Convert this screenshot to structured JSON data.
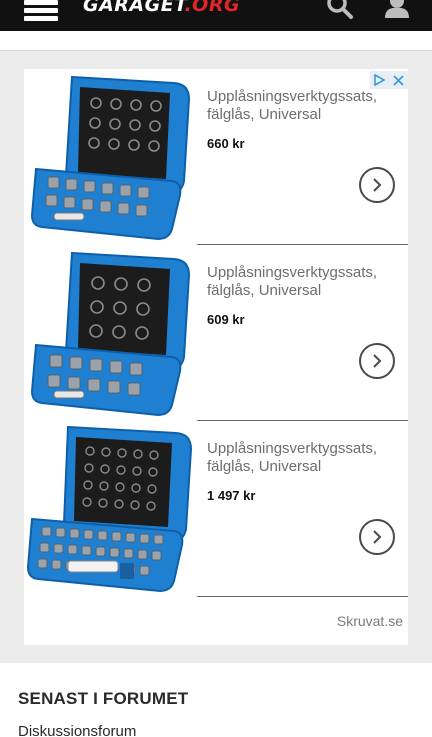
{
  "header": {
    "logo_main": "GARAGET",
    "logo_accent": ".ORG",
    "menu_icon": "hamburger-menu-icon",
    "search_icon": "search-icon",
    "user_icon": "user-icon",
    "background": "#111111",
    "accent_color": "#e0262b"
  },
  "ad": {
    "choices_icons": [
      "adchoices-play-icon",
      "close-icon"
    ],
    "items": [
      {
        "title": "Upplåsningsverktygssats, fälglås, Universal",
        "price": "660 kr",
        "image": "blue-tool-case-image"
      },
      {
        "title": "Upplåsningsverktygssats, fälglås, Universal",
        "price": "609 kr",
        "image": "blue-tool-case-image"
      },
      {
        "title": "Upplåsningsverktygssats, fälglås, Universal",
        "price": "1 497 kr",
        "image": "blue-tool-case-image"
      }
    ],
    "source": "Skruvat.se",
    "case_color": "#1f7fd0"
  },
  "forum": {
    "title": "SENAST I FORUMET",
    "link": "Diskussionsforum"
  }
}
